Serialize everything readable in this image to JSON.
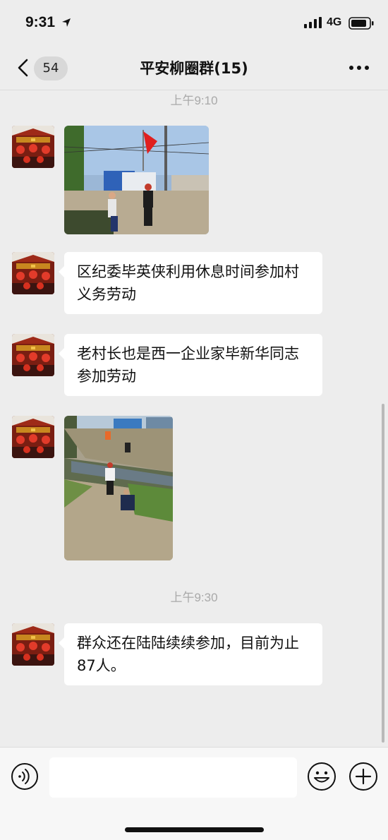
{
  "status_bar": {
    "time": "9:31",
    "network": "4G"
  },
  "nav": {
    "badge": "54",
    "title": "平安柳圈群(15)"
  },
  "messages": [
    {
      "type": "timestamp",
      "text": "上午9:10"
    },
    {
      "type": "image",
      "sender_avatar": "avatar-red-lanterns",
      "description_icon": "photo-flag-workers"
    },
    {
      "type": "text",
      "text": "区纪委毕英侠利用休息时间参加村义务劳动"
    },
    {
      "type": "text",
      "text": "老村长也是西一企业家毕新华同志参加劳动"
    },
    {
      "type": "image",
      "sender_avatar": "avatar-red-lanterns",
      "description_icon": "photo-ditch-workers"
    },
    {
      "type": "timestamp",
      "text": "上午9:30"
    },
    {
      "type": "text",
      "text": "群众还在陆陆续续参加，目前为止87人。"
    }
  ],
  "input": {
    "placeholder": ""
  },
  "colors": {
    "background": "#ededed",
    "bubble": "#ffffff",
    "timestamp": "#a9a9a9"
  }
}
